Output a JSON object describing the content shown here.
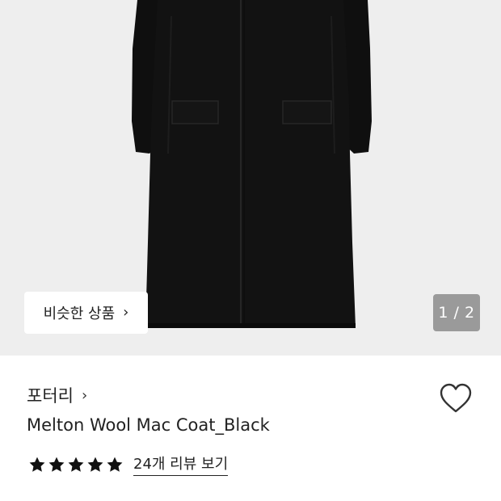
{
  "product_image": {
    "icon": "black-wool-coat-image"
  },
  "similar_button": {
    "label": "비슷한 상품",
    "chevron": "›"
  },
  "image_pager": {
    "text": "1 / 2",
    "current": 1,
    "total": 2
  },
  "brand": {
    "name": "포터리",
    "chevron": "›"
  },
  "wishlist": {
    "icon": "heart-outline-icon"
  },
  "product": {
    "title": "Melton Wool Mac Coat_Black"
  },
  "rating": {
    "stars": 5,
    "max": 5,
    "reviews_link": "24개 리뷰 보기"
  },
  "colors": {
    "hero_bg": "#eeeeee",
    "pager_bg": "#9a9a9a",
    "star": "#111111"
  }
}
